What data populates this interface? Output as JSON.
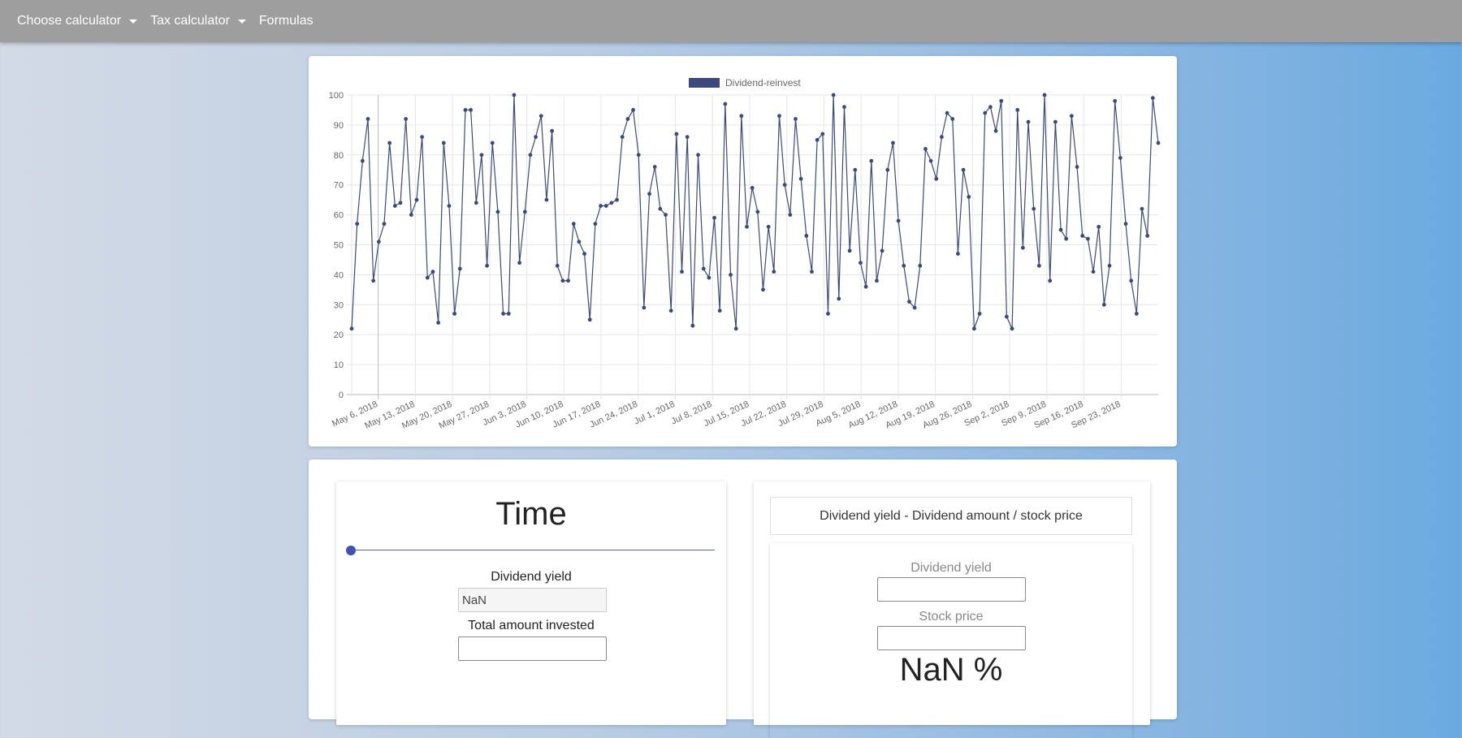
{
  "navbar": {
    "items": [
      {
        "label": "Choose calculator",
        "dropdown": true
      },
      {
        "label": "Tax calculator",
        "dropdown": true
      },
      {
        "label": "Formulas",
        "dropdown": false
      }
    ]
  },
  "chart_data": {
    "type": "line",
    "legend": "Dividend-reinvest",
    "color": "#3b4a7a",
    "ylim": [
      0,
      100
    ],
    "yticks": [
      0,
      10,
      20,
      30,
      40,
      50,
      60,
      70,
      80,
      90,
      100
    ],
    "xlim": [
      "2018-05-01",
      "2018-09-30"
    ],
    "xticks": [
      "May 6, 2018",
      "May 13, 2018",
      "May 20, 2018",
      "May 27, 2018",
      "Jun 3, 2018",
      "Jun 10, 2018",
      "Jun 17, 2018",
      "Jun 24, 2018",
      "Jul 1, 2018",
      "Jul 8, 2018",
      "Jul 15, 2018",
      "Jul 22, 2018",
      "Jul 29, 2018",
      "Aug 5, 2018",
      "Aug 12, 2018",
      "Aug 19, 2018",
      "Aug 26, 2018",
      "Sep 2, 2018",
      "Sep 9, 2018",
      "Sep 16, 2018",
      "Sep 23, 2018"
    ],
    "values": [
      22,
      57,
      78,
      92,
      38,
      51,
      57,
      84,
      63,
      64,
      92,
      60,
      65,
      86,
      39,
      41,
      24,
      84,
      63,
      27,
      42,
      95,
      95,
      64,
      80,
      43,
      84,
      61,
      27,
      27,
      100,
      44,
      61,
      80,
      86,
      93,
      65,
      88,
      43,
      38,
      38,
      57,
      51,
      47,
      25,
      57,
      63,
      63,
      64,
      65,
      86,
      92,
      95,
      80,
      29,
      67,
      76,
      62,
      60,
      28,
      87,
      41,
      86,
      23,
      80,
      42,
      39,
      59,
      28,
      97,
      40,
      22,
      93,
      56,
      69,
      61,
      35,
      56,
      41,
      93,
      70,
      60,
      92,
      72,
      53,
      41,
      85,
      87,
      27,
      100,
      32,
      96,
      48,
      75,
      44,
      36,
      78,
      38,
      48,
      75,
      84,
      58,
      43,
      31,
      29,
      43,
      82,
      78,
      72,
      86,
      94,
      92,
      47,
      75,
      66,
      22,
      27,
      94,
      96,
      88,
      98,
      26,
      22,
      95,
      49,
      91,
      62,
      43,
      100,
      38,
      91,
      55,
      52,
      93,
      76,
      53,
      52,
      41,
      56,
      30,
      43,
      98,
      79,
      57,
      38,
      27,
      62,
      53,
      99,
      84
    ]
  },
  "time_panel": {
    "title": "Time",
    "dividend_yield_label": "Dividend yield",
    "dividend_yield_value": "NaN",
    "total_invested_label": "Total amount invested",
    "total_invested_value": ""
  },
  "yield_panel": {
    "formula": "Dividend yield - Dividend amount / stock price",
    "dividend_yield_label": "Dividend yield",
    "stock_price_label": "Stock price",
    "result": "NaN %"
  }
}
